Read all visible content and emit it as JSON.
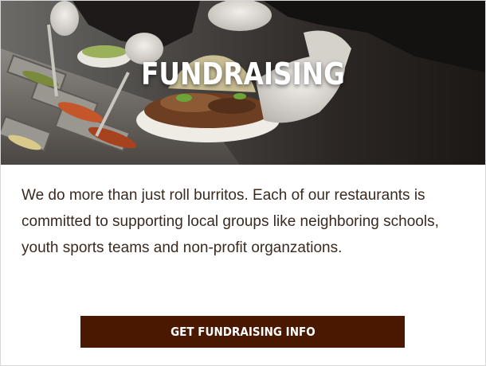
{
  "hero": {
    "title": "FUNDRAISING",
    "image": "burrito-bowl-assembly-photo"
  },
  "description": "We do more than just roll burritos. Each of our restaurants is committed to supporting local groups like neighboring schools, youth sports teams and non-profit organzations.",
  "cta": {
    "label": "GET FUNDRAISING INFO"
  },
  "colors": {
    "button_background": "#4a1700",
    "body_text": "#3a2a20",
    "hero_title": "#ffffff"
  }
}
